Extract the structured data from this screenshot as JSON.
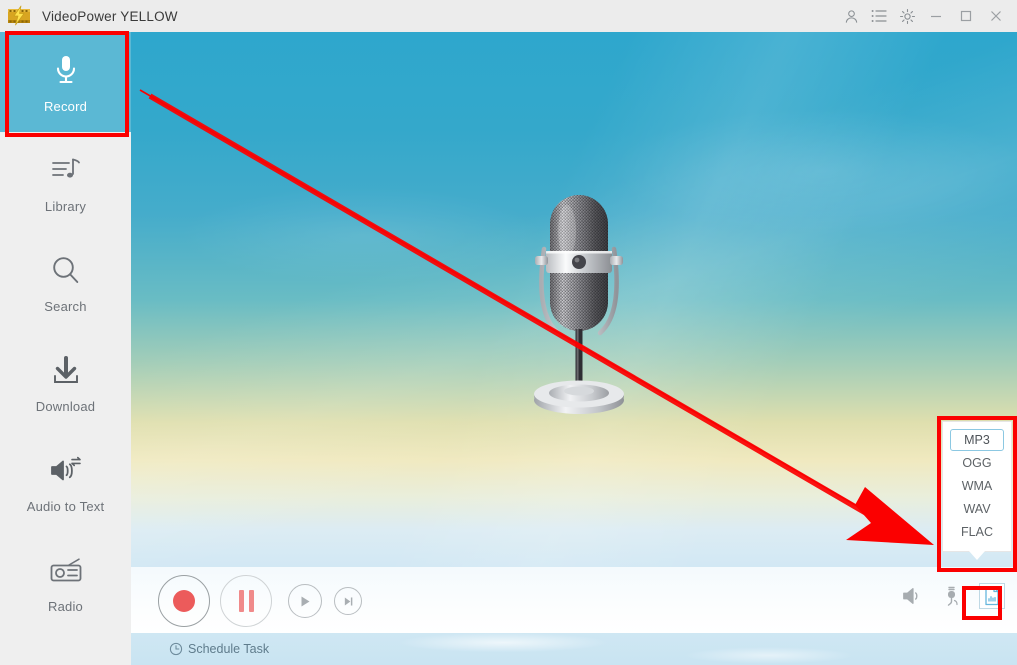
{
  "window": {
    "title": "VideoPower YELLOW",
    "logo_icon": "videopower-logo-icon",
    "controls": {
      "account_icon": "user-icon",
      "list_icon": "list-icon",
      "settings_icon": "gear-icon",
      "minimize_icon": "minimize-icon",
      "maximize_icon": "maximize-icon",
      "close_icon": "close-icon"
    }
  },
  "sidebar": {
    "items": [
      {
        "label": "Record",
        "icon": "microphone-icon",
        "active": true
      },
      {
        "label": "Library",
        "icon": "library-music-icon",
        "active": false
      },
      {
        "label": "Search",
        "icon": "magnifier-icon",
        "active": false
      },
      {
        "label": "Download",
        "icon": "download-icon",
        "active": false
      },
      {
        "label": "Audio to Text",
        "icon": "audio-to-text-icon",
        "active": false
      },
      {
        "label": "Radio",
        "icon": "radio-icon",
        "active": false
      }
    ]
  },
  "stage": {
    "artwork_icon": "studio-microphone-artwork"
  },
  "controls": {
    "record_icon": "record-dot-icon",
    "pause_icon": "pause-icon",
    "play_icon": "play-icon",
    "next_icon": "next-track-icon",
    "speaker_icon": "speaker-icon",
    "microphone_input_icon": "microphone-plug-icon",
    "format_icon": "audio-file-format-icon"
  },
  "schedule": {
    "label": "Schedule Task",
    "icon": "clock-icon"
  },
  "format_popup": {
    "options": [
      "MP3",
      "OGG",
      "WMA",
      "WAV",
      "FLAC"
    ],
    "selected": "MP3"
  },
  "annotations": {
    "highlight_color": "#fb0000",
    "arrow": "red-diagonal-arrow",
    "boxes": [
      "record-sidebar-item",
      "format-options-popup",
      "format-toggle-button"
    ]
  },
  "colors": {
    "titlebar": "#ececec",
    "sidebar": "#efefef",
    "active_item": "#5bb8d4",
    "sky_top": "#2ea7cd",
    "sky_mid": "#f0e9bf",
    "record_dot": "#ec5b5b",
    "selected_outline": "#8cc8e2"
  }
}
